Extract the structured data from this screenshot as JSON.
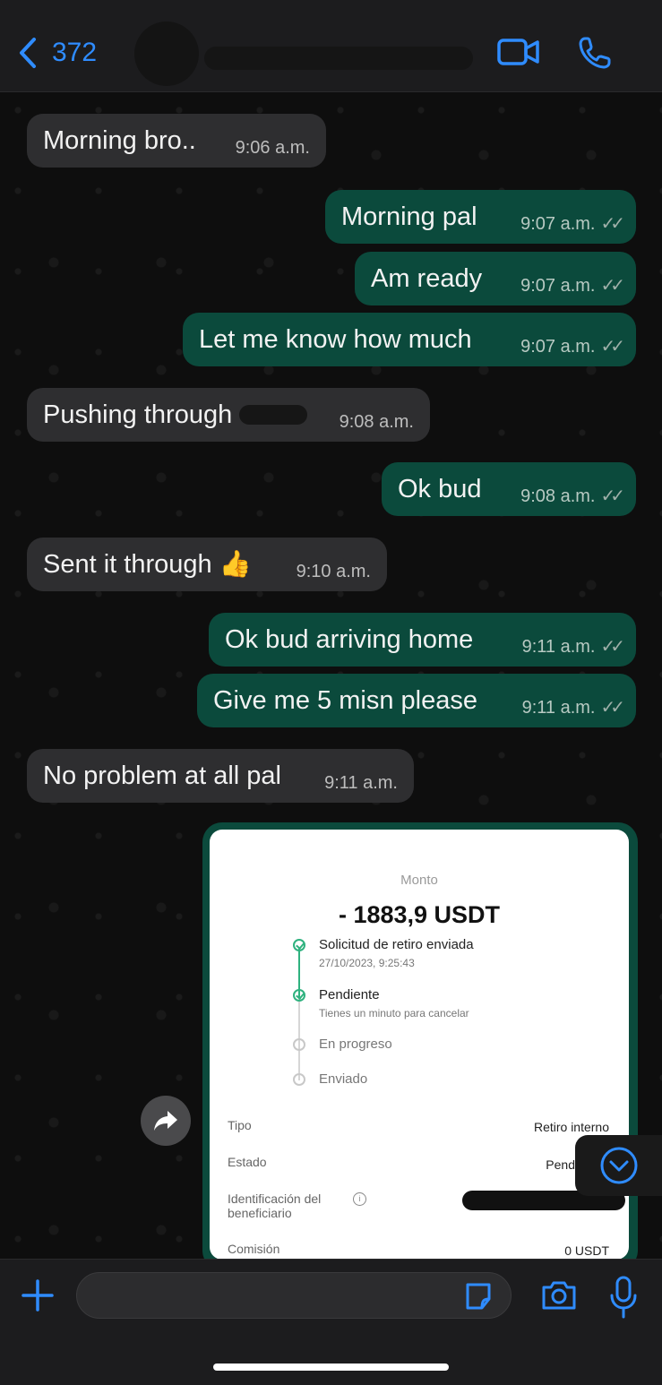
{
  "header": {
    "back_count": "372",
    "icons": [
      "chevron-left-icon",
      "video-call-icon",
      "phone-icon"
    ]
  },
  "messages": [
    {
      "dir": "in",
      "text": "Morning bro..",
      "time": "9:06 a.m."
    },
    {
      "dir": "out",
      "text": "Morning pal",
      "time": "9:07 a.m."
    },
    {
      "dir": "out",
      "text": "Am ready",
      "time": "9:07 a.m."
    },
    {
      "dir": "out",
      "text": "Let me know how much",
      "time": "9:07 a.m."
    },
    {
      "dir": "in",
      "text": "Pushing through",
      "time": "9:08 a.m."
    },
    {
      "dir": "out",
      "text": "Ok bud",
      "time": "9:08 a.m."
    },
    {
      "dir": "in",
      "text": "Sent it through 👍",
      "time": "9:10 a.m."
    },
    {
      "dir": "out",
      "text": "Ok bud arriving home",
      "time": "9:11 a.m."
    },
    {
      "dir": "out",
      "text": "Give me 5 misn please",
      "time": "9:11 a.m."
    },
    {
      "dir": "in",
      "text": "No problem at all pal",
      "time": "9:11 a.m."
    }
  ],
  "receipt": {
    "monto_label": "Monto",
    "amount": "- 1883,9 USDT",
    "steps": [
      {
        "title": "Solicitud de retiro enviada",
        "sub": "27/10/2023, 9:25:43",
        "done": true
      },
      {
        "title": "Pendiente",
        "sub": "Tienes un minuto para cancelar",
        "done": true
      },
      {
        "title": "En progreso",
        "sub": "",
        "done": false
      },
      {
        "title": "Enviado",
        "sub": "",
        "done": false
      }
    ],
    "rows": [
      {
        "label": "Tipo",
        "value": "Retiro interno"
      },
      {
        "label": "Estado",
        "value": "Pend"
      },
      {
        "label": "Identificación del beneficiario",
        "value": ""
      },
      {
        "label": "Comisión",
        "value": "0 USDT"
      }
    ]
  },
  "composer": {
    "placeholder": "",
    "icons": [
      "plus-icon",
      "sticker-icon",
      "camera-icon",
      "microphone-icon"
    ]
  },
  "colors": {
    "accent": "#2f8cff",
    "outgoing_bubble": "#0b4a3c",
    "incoming_bubble": "#2e2e30",
    "check": "#2fb27f"
  }
}
